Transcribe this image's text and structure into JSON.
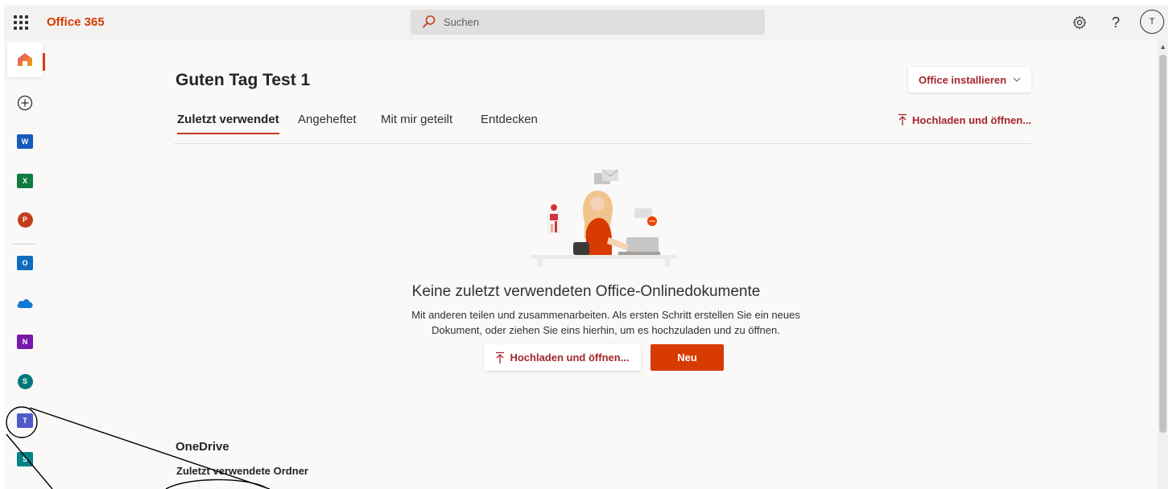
{
  "header": {
    "app_title": "Office 365",
    "search_placeholder": "Suchen",
    "avatar_initial": "T",
    "icons": {
      "launcher": "waffle-icon",
      "search": "search-icon",
      "settings": "gear-icon",
      "help": "help-icon"
    }
  },
  "rail": {
    "items": [
      {
        "name": "Home",
        "icon": "home-icon"
      },
      {
        "name": "Create",
        "icon": "plus-circle-icon"
      },
      {
        "name": "Word",
        "icon": "word-icon",
        "letter": "W",
        "color": "#185abd"
      },
      {
        "name": "Excel",
        "icon": "excel-icon",
        "letter": "X",
        "color": "#107c41"
      },
      {
        "name": "PowerPoint",
        "icon": "powerpoint-icon",
        "letter": "P",
        "color": "#c43e1c"
      },
      {
        "name": "Outlook",
        "icon": "outlook-icon",
        "letter": "O",
        "color": "#0f6cbd"
      },
      {
        "name": "OneDrive",
        "icon": "onedrive-icon",
        "color": "#0f78d4"
      },
      {
        "name": "OneNote",
        "icon": "onenote-icon",
        "letter": "N",
        "color": "#7719aa"
      },
      {
        "name": "SharePoint",
        "icon": "sharepoint-icon",
        "letter": "S",
        "color": "#03787c"
      },
      {
        "name": "Teams",
        "icon": "teams-icon",
        "letter": "T",
        "color": "#5059c9"
      },
      {
        "name": "Sway",
        "icon": "sway-icon",
        "letter": "S",
        "color": "#038387"
      }
    ]
  },
  "main": {
    "greeting": "Guten Tag Test 1",
    "install_button": "Office installieren",
    "tabs": [
      {
        "label": "Zuletzt verwendet",
        "active": true
      },
      {
        "label": "Angeheftet",
        "active": false
      },
      {
        "label": "Mit mir geteilt",
        "active": false
      },
      {
        "label": "Entdecken",
        "active": false
      }
    ],
    "upload_link": "Hochladen und öffnen...",
    "empty_state": {
      "title": "Keine zuletzt verwendeten Office-Onlinedokumente",
      "description_line1": "Mit anderen teilen und zusammenarbeiten. Als ersten Schritt erstellen Sie ein neues",
      "description_line2": "Dokument, oder ziehen Sie eins hierhin, um es hochzuladen und zu öffnen.",
      "upload_button": "Hochladen und öffnen...",
      "new_button": "Neu"
    },
    "onedrive_section": {
      "title": "OneDrive",
      "subtitle": "Zuletzt verwendete Ordner"
    }
  },
  "colors": {
    "accent": "#d83b01",
    "link": "#a4262c",
    "background": "#faf9f8",
    "header_bg": "#f3f2f1"
  }
}
